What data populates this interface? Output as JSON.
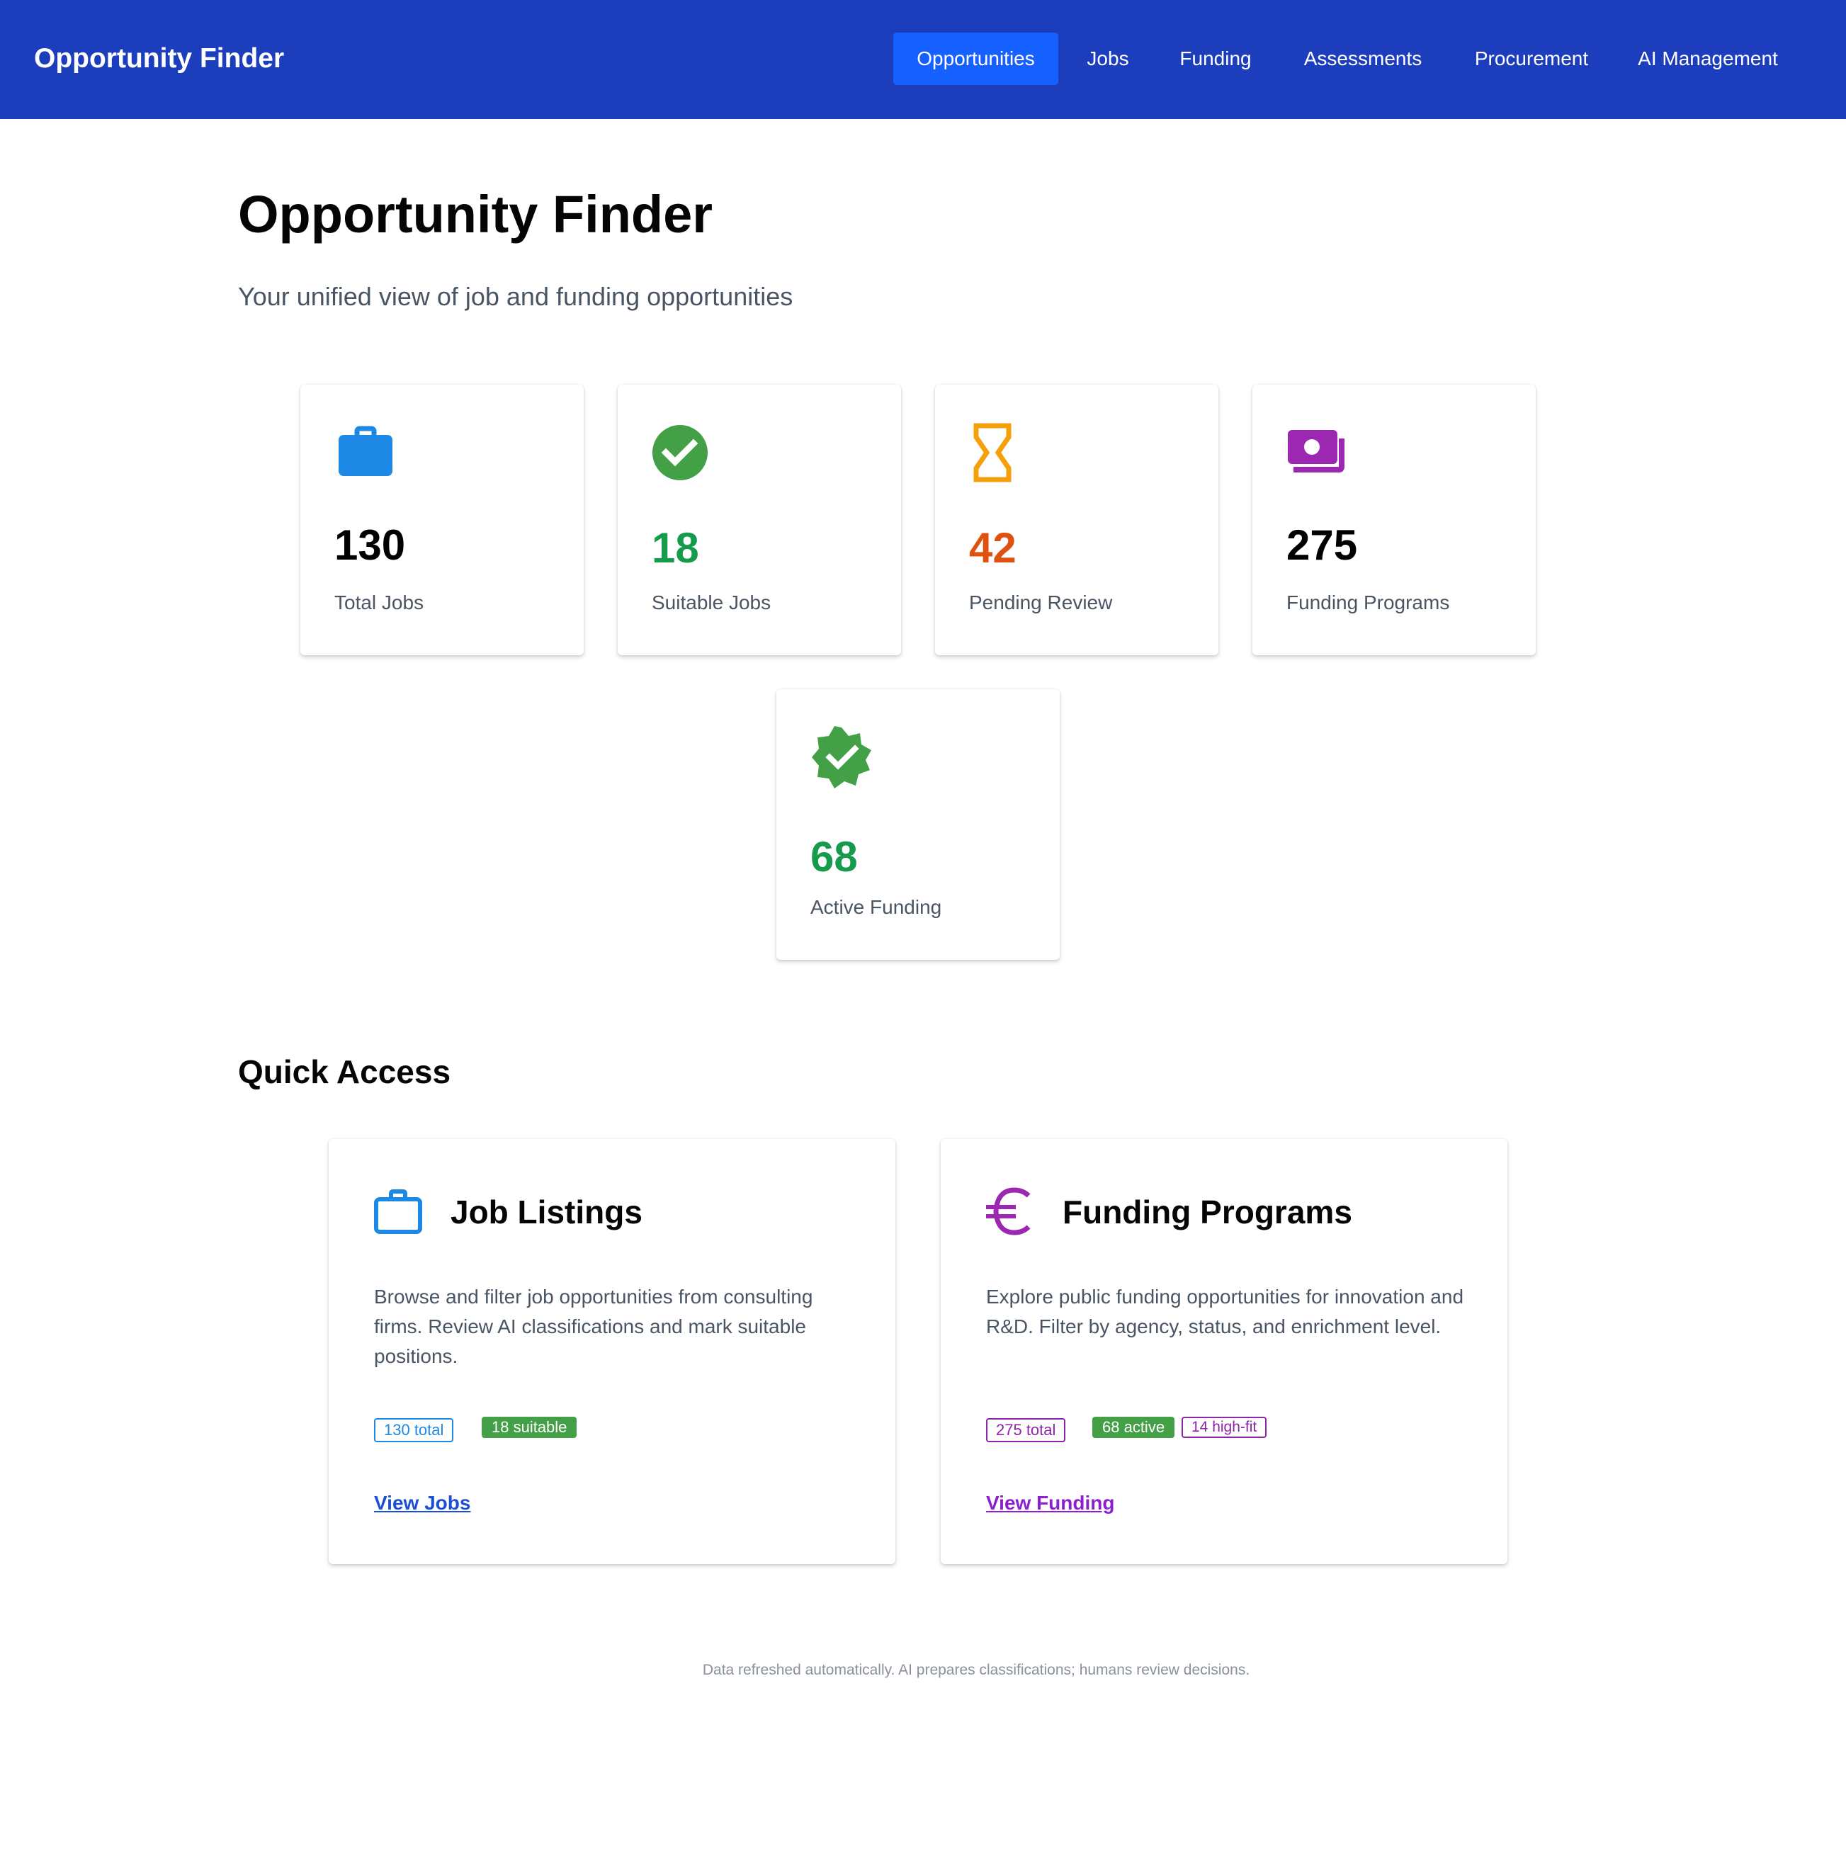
{
  "app": {
    "brand": "Opportunity Finder"
  },
  "nav": {
    "items": [
      {
        "label": "Opportunities",
        "active": true
      },
      {
        "label": "Jobs",
        "active": false
      },
      {
        "label": "Funding",
        "active": false
      },
      {
        "label": "Assessments",
        "active": false
      },
      {
        "label": "Procurement",
        "active": false
      },
      {
        "label": "AI Management",
        "active": false
      }
    ],
    "active_color": "#1560ff",
    "bar_color": "#1c3ebd"
  },
  "header": {
    "title": "Opportunity Finder",
    "subtitle": "Your unified view of job and funding opportunities"
  },
  "stats": [
    {
      "value": "130",
      "label": "Total Jobs",
      "icon": "briefcase-icon",
      "color": "#000000",
      "icon_color": "#1e88e5"
    },
    {
      "value": "18",
      "label": "Suitable Jobs",
      "icon": "check-circle-icon",
      "color": "#169a4c",
      "icon_color": "#43a047"
    },
    {
      "value": "42",
      "label": "Pending Review",
      "icon": "hourglass-icon",
      "color": "#e0510f",
      "icon_color": "#f5a00a"
    },
    {
      "value": "275",
      "label": "Funding Programs",
      "icon": "money-stack-icon",
      "color": "#000000",
      "icon_color": "#9c27b0"
    },
    {
      "value": "68",
      "label": "Active Funding",
      "icon": "verified-badge-icon",
      "color": "#169a4c",
      "icon_color": "#43a047"
    }
  ],
  "quick_access": {
    "title": "Quick Access",
    "cards": [
      {
        "title": "Job Listings",
        "icon": "briefcase-outline-icon",
        "description": "Browse and filter job opportunities from consulting firms. Review AI classifications and mark suitable positions.",
        "badges": [
          "130 total",
          "18 suitable"
        ],
        "link": "View Jobs",
        "link_color": "#1a4fd6"
      },
      {
        "title": "Funding Programs",
        "icon": "euro-icon",
        "description": "Explore public funding opportunities for innovation and R&D. Filter by agency, status, and enrichment level.",
        "badges": [
          "275 total",
          "68 active",
          "14 high-fit"
        ],
        "link": "View Funding",
        "link_color": "#8e1fd1"
      }
    ]
  },
  "footer": {
    "note": "Data refreshed automatically. AI prepares classifications; humans review decisions."
  }
}
